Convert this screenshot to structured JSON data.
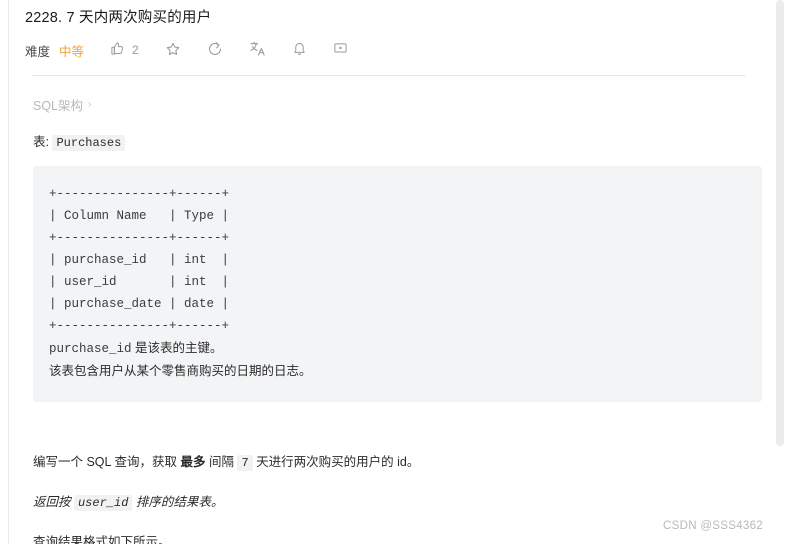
{
  "problem": {
    "title": "2228. 7 天内两次购买的用户"
  },
  "toolbar": {
    "difficulty_label": "难度",
    "difficulty_value": "中等",
    "difficulty_color": "#f2a33c",
    "like_count": "2",
    "items": [
      {
        "name": "like-icon",
        "label": "点赞"
      },
      {
        "name": "star-icon",
        "label": "收藏"
      },
      {
        "name": "refresh-icon",
        "label": "重置"
      },
      {
        "name": "translate-icon",
        "label": "翻译"
      },
      {
        "name": "bell-icon",
        "label": "订阅"
      },
      {
        "name": "comment-icon",
        "label": "讨论"
      }
    ]
  },
  "schema": {
    "toggle_label": "SQL架构",
    "toggle_chevron": "›"
  },
  "table_section": {
    "caption_prefix": "表:",
    "table_name": "Purchases",
    "ascii_table": "+---------------+------+\n| Column Name   | Type |\n+---------------+------+\n| purchase_id   | int  |\n| user_id       | int  |\n| purchase_date | date |\n+---------------+------+",
    "note_key": "purchase_id",
    "note_line1_rest": " 是该表的主键。",
    "note_line2": "该表包含用户从某个零售商购买的日期的日志。"
  },
  "description": {
    "p1_a": "编写一个 SQL 查询，获取 ",
    "p1_bold": "最多",
    "p1_b": " 间隔 ",
    "p1_code": "7",
    "p1_c": " 天进行两次购买的用户的 id。",
    "p2_a": "返回按 ",
    "p2_code": "user_id",
    "p2_b": " 排序的结果表。",
    "p3": "查询结果格式如下所示。"
  },
  "watermark": {
    "text": "CSDN @SSS4362"
  }
}
